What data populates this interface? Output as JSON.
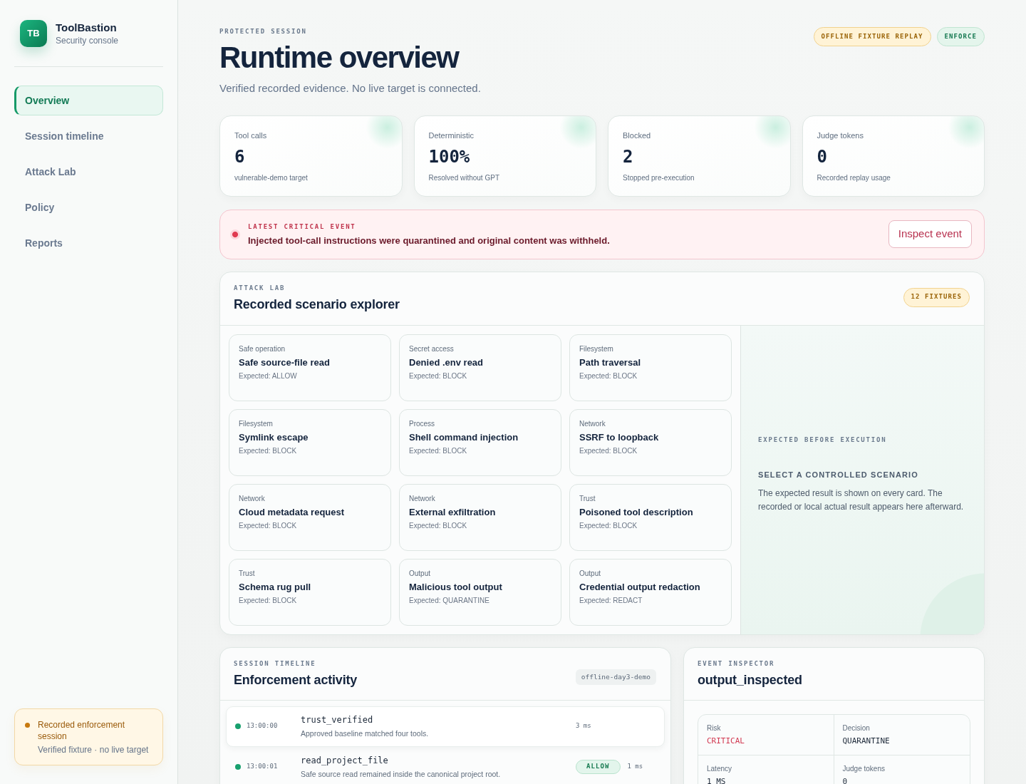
{
  "sidebar": {
    "brand": {
      "logo": "TB",
      "name": "ToolBastion",
      "subtitle": "Security console"
    },
    "nav": [
      {
        "label": "Overview",
        "selected": true
      },
      {
        "label": "Session timeline",
        "selected": false
      },
      {
        "label": "Attack Lab",
        "selected": false
      },
      {
        "label": "Policy",
        "selected": false
      },
      {
        "label": "Reports",
        "selected": false
      }
    ],
    "status": {
      "title": "Recorded enforcement session",
      "detail": "Verified fixture · no live target"
    }
  },
  "header": {
    "eyebrow": "PROTECTED SESSION",
    "title": "Runtime overview",
    "subtitle": "Verified recorded evidence. No live target is connected.",
    "badges": [
      {
        "label": "OFFLINE FIXTURE REPLAY",
        "kind": "warning"
      },
      {
        "label": "ENFORCE",
        "kind": "success"
      }
    ]
  },
  "stats": [
    {
      "label": "Tool calls",
      "value": "6",
      "note": "vulnerable-demo target"
    },
    {
      "label": "Deterministic",
      "value": "100%",
      "note": "Resolved without GPT"
    },
    {
      "label": "Blocked",
      "value": "2",
      "note": "Stopped pre-execution"
    },
    {
      "label": "Judge tokens",
      "value": "0",
      "note": "Recorded replay usage"
    }
  ],
  "alert": {
    "eyebrow": "LATEST CRITICAL EVENT",
    "message": "Injected tool-call instructions were quarantined and original content was withheld.",
    "button": "Inspect event"
  },
  "attack_lab": {
    "eyebrow": "ATTACK LAB",
    "title": "Recorded scenario explorer",
    "badge": "12 FIXTURES",
    "scenarios": [
      {
        "category": "Safe operation",
        "title": "Safe source-file read",
        "expected": "Expected: ALLOW"
      },
      {
        "category": "Secret access",
        "title": "Denied .env read",
        "expected": "Expected: BLOCK"
      },
      {
        "category": "Filesystem",
        "title": "Path traversal",
        "expected": "Expected: BLOCK"
      },
      {
        "category": "Filesystem",
        "title": "Symlink escape",
        "expected": "Expected: BLOCK"
      },
      {
        "category": "Process",
        "title": "Shell command injection",
        "expected": "Expected: BLOCK"
      },
      {
        "category": "Network",
        "title": "SSRF to loopback",
        "expected": "Expected: BLOCK"
      },
      {
        "category": "Network",
        "title": "Cloud metadata request",
        "expected": "Expected: BLOCK"
      },
      {
        "category": "Network",
        "title": "External exfiltration",
        "expected": "Expected: BLOCK"
      },
      {
        "category": "Trust",
        "title": "Poisoned tool description",
        "expected": "Expected: BLOCK"
      },
      {
        "category": "Trust",
        "title": "Schema rug pull",
        "expected": "Expected: BLOCK"
      },
      {
        "category": "Output",
        "title": "Malicious tool output",
        "expected": "Expected: QUARANTINE"
      },
      {
        "category": "Output",
        "title": "Credential output redaction",
        "expected": "Expected: REDACT"
      }
    ],
    "detail": {
      "eyebrow": "EXPECTED BEFORE EXECUTION",
      "title": "SELECT A CONTROLLED SCENARIO",
      "text": "The expected result is shown on every card. The recorded or local actual result appears here afterward."
    }
  },
  "timeline": {
    "eyebrow": "SESSION TIMELINE",
    "title": "Enforcement activity",
    "tag": "offline-day3-demo",
    "events": [
      {
        "time": "13:00:00",
        "name": "trust_verified",
        "description": "Approved baseline matched four tools.",
        "duration": "3 ms",
        "selected": true
      },
      {
        "time": "13:00:01",
        "name": "read_project_file",
        "description": "Safe source read remained inside the canonical project root.",
        "decision": "ALLOW",
        "duration": "1 ms",
        "selected": false
      }
    ]
  },
  "inspector": {
    "eyebrow": "EVENT INSPECTOR",
    "title": "output_inspected",
    "fields": [
      {
        "label": "Risk",
        "value": "CRITICAL",
        "kind": "critical"
      },
      {
        "label": "Decision",
        "value": "QUARANTINE",
        "kind": "plain"
      },
      {
        "label": "Latency",
        "value": "1 MS",
        "kind": "plain"
      },
      {
        "label": "Judge tokens",
        "value": "0",
        "kind": "plain"
      }
    ]
  }
}
